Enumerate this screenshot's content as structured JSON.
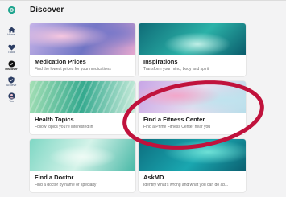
{
  "header": {
    "title": "Discover",
    "logo_icon": "app-logo-icon"
  },
  "sidebar": {
    "items": [
      {
        "label": "Home",
        "icon": "home-icon",
        "active": false
      },
      {
        "label": "Track",
        "icon": "heart-icon",
        "active": false
      },
      {
        "label": "Discover",
        "icon": "compass-icon",
        "active": true
      },
      {
        "label": "Achieve",
        "icon": "shield-icon",
        "active": false
      },
      {
        "label": "You",
        "icon": "person-icon",
        "active": false
      }
    ]
  },
  "cards": [
    {
      "title": "Medication Prices",
      "subtitle": "Find the lowest prices for your medications"
    },
    {
      "title": "Inspirations",
      "subtitle": "Transform your mind, body and spirit"
    },
    {
      "title": "Health Topics",
      "subtitle": "Follow topics you're interested in"
    },
    {
      "title": "Find a Fitness Center",
      "subtitle": "Find a Prime Fitness Center near you"
    },
    {
      "title": "Find a Doctor",
      "subtitle": "Find a doctor by name or specialty"
    },
    {
      "title": "AskMD",
      "subtitle": "Identify what's wrong and what you can do ab..."
    }
  ],
  "colors": {
    "accent": "#1fa58f",
    "annotation_circle": "#c0123c",
    "background": "#f3f3f4",
    "nav_icon": "#2c3d63"
  }
}
